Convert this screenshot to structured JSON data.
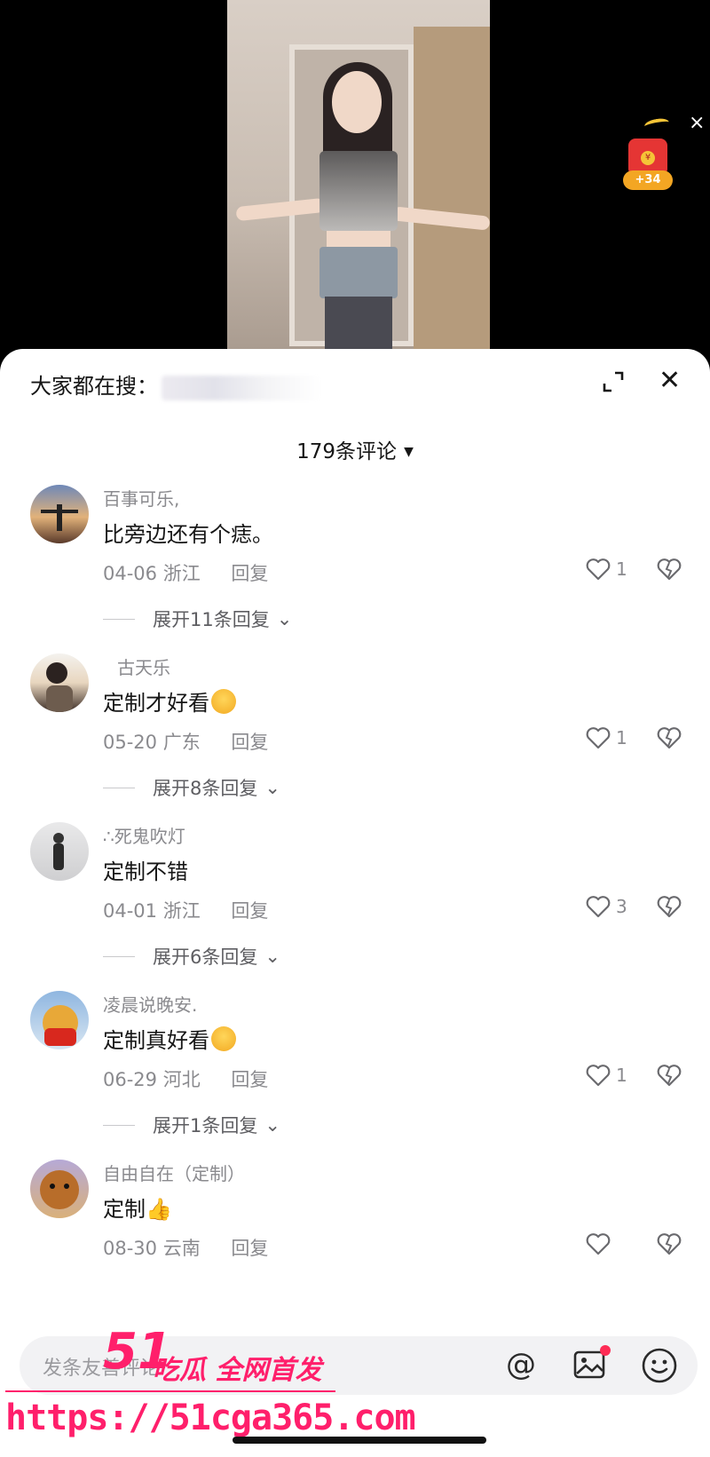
{
  "video": {
    "red_packet_amount": "+34"
  },
  "sheet": {
    "search_hint": "大家都在搜：",
    "comment_count": "179条评论"
  },
  "comments": [
    {
      "user": "百事可乐,",
      "text": "比旁边还有个痣。",
      "date": "04-06",
      "location": "浙江",
      "reply": "回复",
      "likes": "1",
      "expand": "展开11条回复"
    },
    {
      "user": "古天乐",
      "text": "定制才好看",
      "date": "05-20",
      "location": "广东",
      "reply": "回复",
      "likes": "1",
      "expand": "展开8条回复"
    },
    {
      "user": "∴死鬼吹灯",
      "text": "定制不错",
      "date": "04-01",
      "location": "浙江",
      "reply": "回复",
      "likes": "3",
      "expand": "展开6条回复"
    },
    {
      "user": "凌晨说晚安.",
      "text": "定制真好看",
      "date": "06-29",
      "location": "河北",
      "reply": "回复",
      "likes": "1",
      "expand": "展开1条回复"
    },
    {
      "user": "自由自在（定制）",
      "text": "定制",
      "date": "08-30",
      "location": "云南",
      "reply": "回复",
      "likes": "",
      "expand": ""
    }
  ],
  "input": {
    "placeholder": "发条友善评论"
  },
  "watermark": {
    "brand_num": "51",
    "brand_tag": "吃瓜 全网首发",
    "url": "https://51cga365.com"
  },
  "colors": {
    "accent": "#fe2c55",
    "watermark": "#ff1f6b",
    "muted": "#8a8a8e"
  }
}
